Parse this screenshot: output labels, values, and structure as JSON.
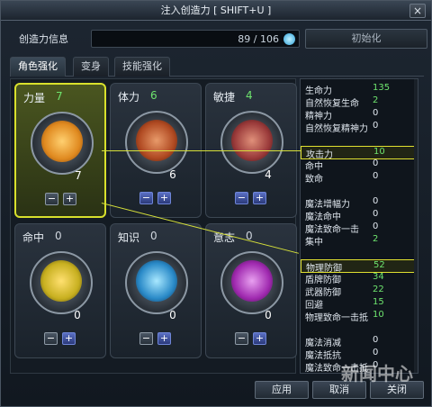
{
  "window": {
    "title": "注入创造力 [ SHIFT+U ]",
    "close_label": "×"
  },
  "info": {
    "label": "创造力信息",
    "value": "89 / 106",
    "init_button": "初始化"
  },
  "tabs": [
    {
      "label": "角色强化"
    },
    {
      "label": "变身"
    },
    {
      "label": "技能强化"
    }
  ],
  "attributes": [
    {
      "name": "力量",
      "value": "7",
      "level": "7",
      "icon": "fist-icon",
      "color": "#e08a20"
    },
    {
      "name": "体力",
      "value": "6",
      "level": "6",
      "icon": "muscle-man-icon",
      "color": "#b04a22"
    },
    {
      "name": "敏捷",
      "value": "4",
      "level": "4",
      "icon": "running-legs-icon",
      "color": "#9a3a3a"
    },
    {
      "name": "命中",
      "value": "0",
      "level": "0",
      "icon": "target-face-icon",
      "color": "#c8b020"
    },
    {
      "name": "知识",
      "value": "0",
      "level": "0",
      "icon": "glowing-head-icon",
      "color": "#2a8ac8"
    },
    {
      "name": "意志",
      "value": "0",
      "level": "0",
      "icon": "masked-face-icon",
      "color": "#a02ab0"
    }
  ],
  "stats": [
    {
      "label": "生命力",
      "value": "135"
    },
    {
      "label": "自然恢复生命",
      "value": "2"
    },
    {
      "label": "精神力",
      "value": "0"
    },
    {
      "label": "自然恢复精神力",
      "value": "0"
    },
    {
      "label": "",
      "value": ""
    },
    {
      "label": "攻击力",
      "value": "10"
    },
    {
      "label": "命中",
      "value": "0"
    },
    {
      "label": "致命",
      "value": "0"
    },
    {
      "label": "",
      "value": ""
    },
    {
      "label": "魔法增幅力",
      "value": "0"
    },
    {
      "label": "魔法命中",
      "value": "0"
    },
    {
      "label": "魔法致命一击",
      "value": "0"
    },
    {
      "label": "集中",
      "value": "2"
    },
    {
      "label": "",
      "value": ""
    },
    {
      "label": "物理防御",
      "value": "52"
    },
    {
      "label": "盾牌防御",
      "value": "34"
    },
    {
      "label": "武器防御",
      "value": "22"
    },
    {
      "label": "回避",
      "value": "15"
    },
    {
      "label": "物理致命一击抵",
      "value": "10"
    },
    {
      "label": "",
      "value": ""
    },
    {
      "label": "魔法消减",
      "value": "0"
    },
    {
      "label": "魔法抵抗",
      "value": "0"
    },
    {
      "label": "魔法致命一击抵",
      "value": "0"
    }
  ],
  "buttons": {
    "apply": "应用",
    "cancel": "取消",
    "close": "关闭"
  },
  "watermark": "新闻中心"
}
